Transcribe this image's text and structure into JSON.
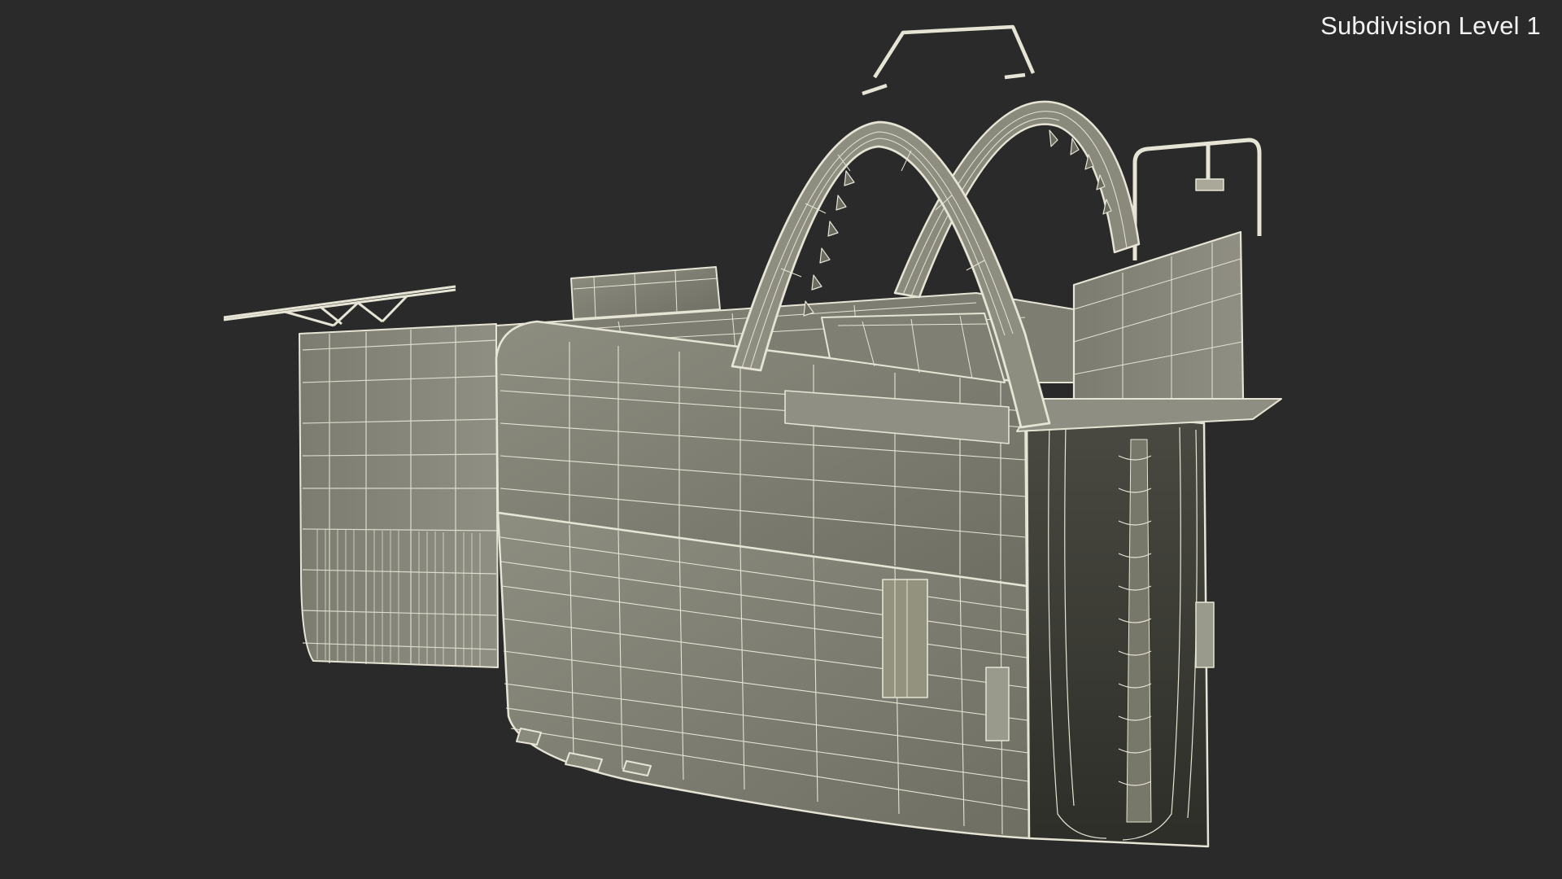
{
  "viewport": {
    "overlay_label": "Subdivision Level 1",
    "background_color": "#2a2a2a",
    "mesh_fill_color": "#8a8a7c",
    "mesh_wire_color": "#e6e4d4"
  }
}
